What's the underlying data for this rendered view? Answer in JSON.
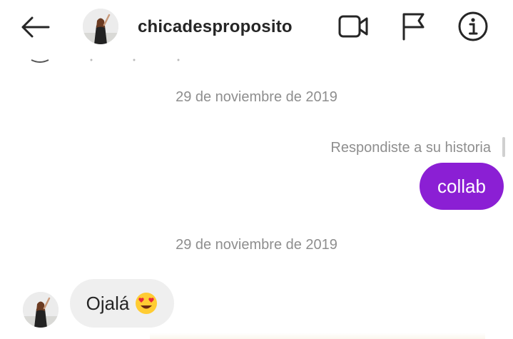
{
  "header": {
    "username": "chicadesproposito",
    "icons": {
      "back": "arrow-left-icon",
      "video": "video-call-icon",
      "flag": "flag-icon",
      "info": "info-icon"
    }
  },
  "messages": {
    "date_separator_1": "29 de noviembre de 2019",
    "reply_note": "Respondiste a su historia",
    "outgoing_text": "collab",
    "date_separator_2": "29 de noviembre de 2019",
    "incoming_text": "Ojalá",
    "incoming_emoji": "heart-eyes-emoji-icon"
  },
  "colors": {
    "outgoing_bubble": "#8b1fd4",
    "incoming_bubble": "#efefef",
    "muted_text": "#8e8e8e",
    "primary_text": "#262626"
  }
}
